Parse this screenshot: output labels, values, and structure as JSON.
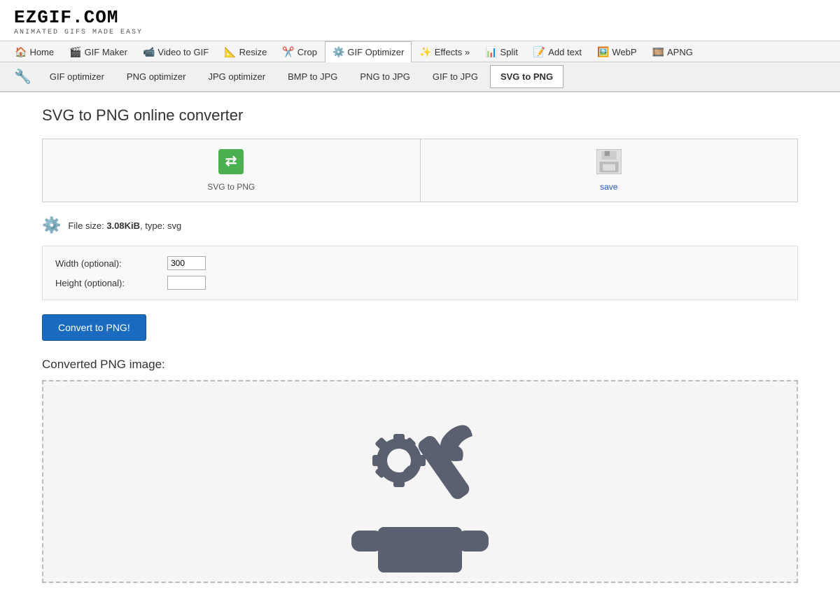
{
  "logo": {
    "main": "EZGIF.COM",
    "sub": "ANIMATED GIFS MADE EASY"
  },
  "nav": {
    "items": [
      {
        "id": "home",
        "label": "Home",
        "icon": "🏠"
      },
      {
        "id": "gif-maker",
        "label": "GIF Maker",
        "icon": "🎬"
      },
      {
        "id": "video-to-gif",
        "label": "Video to GIF",
        "icon": "📹"
      },
      {
        "id": "resize",
        "label": "Resize",
        "icon": "📐"
      },
      {
        "id": "crop",
        "label": "Crop",
        "icon": "✂️"
      },
      {
        "id": "gif-optimizer",
        "label": "GIF Optimizer",
        "icon": "⚙️",
        "active": true
      },
      {
        "id": "effects",
        "label": "Effects »",
        "icon": "✨"
      },
      {
        "id": "split",
        "label": "Split",
        "icon": "📊"
      },
      {
        "id": "add-text",
        "label": "Add text",
        "icon": "📝"
      },
      {
        "id": "webp",
        "label": "WebP",
        "icon": "🖼️"
      },
      {
        "id": "apng",
        "label": "APNG",
        "icon": "🎞️"
      }
    ]
  },
  "subnav": {
    "items": [
      {
        "id": "gif-optimizer",
        "label": "GIF optimizer"
      },
      {
        "id": "png-optimizer",
        "label": "PNG optimizer"
      },
      {
        "id": "jpg-optimizer",
        "label": "JPG optimizer"
      },
      {
        "id": "bmp-to-jpg",
        "label": "BMP to JPG"
      },
      {
        "id": "png-to-jpg",
        "label": "PNG to JPG"
      },
      {
        "id": "gif-to-jpg",
        "label": "GIF to JPG"
      },
      {
        "id": "svg-to-png",
        "label": "SVG to PNG",
        "active": true
      }
    ]
  },
  "page": {
    "title": "SVG to PNG online converter",
    "action_svg_label": "SVG to PNG",
    "action_save_label": "save",
    "file_info": {
      "size": "3.08KiB",
      "type": "svg",
      "prefix": "File size: ",
      "suffix": ", type: svg"
    },
    "options": {
      "width_label": "Width (optional):",
      "width_value": "300",
      "height_label": "Height (optional):",
      "height_value": ""
    },
    "convert_button": "Convert to PNG!",
    "converted_section_title": "Converted PNG image:"
  }
}
